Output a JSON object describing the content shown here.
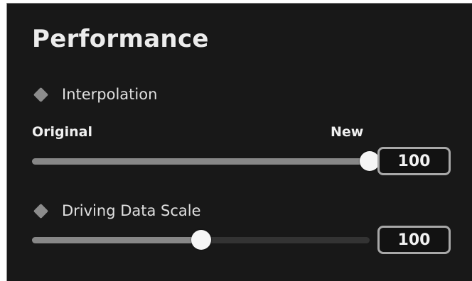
{
  "panel": {
    "title": "Performance"
  },
  "interpolation": {
    "label": "Interpolation",
    "icon": "diamond-icon",
    "min_label": "Original",
    "max_label": "New",
    "value": "100",
    "level_percent": 100
  },
  "driving_data_scale": {
    "label": "Driving Data Scale",
    "icon": "diamond-icon",
    "value": "100",
    "level_percent": 50
  },
  "colors": {
    "background": "#181818",
    "text": "#e6e6e6",
    "track_fill": "#878787",
    "track_empty": "#333333",
    "thumb": "#f5f5f5"
  }
}
